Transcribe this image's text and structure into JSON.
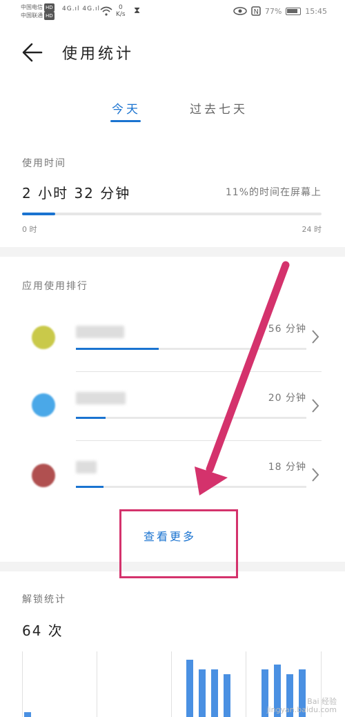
{
  "status_bar": {
    "carrier1": "中国电信",
    "carrier2": "中国联通",
    "hd": "HD",
    "signal": "4G.ıl 4G.ıl",
    "speed_value": "0",
    "speed_unit": "K/s",
    "battery": "77%",
    "time": "15:45"
  },
  "header": {
    "title": "使用统计"
  },
  "tabs": [
    {
      "label": "今天",
      "selected": true
    },
    {
      "label": "过去七天",
      "selected": false
    }
  ],
  "usage": {
    "label": "使用时间",
    "total": "2 小时 32 分钟",
    "percent_text": "11%的时间在屏幕上",
    "fraction": 0.11,
    "axis_start": "0 时",
    "axis_end": "24 时"
  },
  "ranking": {
    "title": "应用使用排行",
    "apps": [
      {
        "time": "56 分钟",
        "fraction": 0.36,
        "icon_color": "#c9c94a"
      },
      {
        "time": "20 分钟",
        "fraction": 0.13,
        "icon_color": "#4aa8e8"
      },
      {
        "time": "18 分钟",
        "fraction": 0.12,
        "icon_color": "#b05050"
      }
    ],
    "see_more": "查看更多"
  },
  "unlock": {
    "label": "解锁统计",
    "count": "64 次",
    "bars": [
      1,
      0,
      0,
      0,
      0,
      0,
      0,
      0,
      0,
      0,
      0,
      0,
      0,
      12,
      10,
      10,
      9,
      0,
      0,
      10,
      11,
      9,
      10
    ],
    "bar_color": "#4a90e2"
  },
  "annotation": {
    "color": "#d4326c"
  },
  "watermark": {
    "line1": "Bai 经验",
    "line2": "jingyan.baidu.com"
  }
}
